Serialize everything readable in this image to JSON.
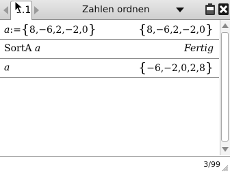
{
  "titlebar": {
    "tab_label": "1.1",
    "document_title": "Zahlen ordnen",
    "icons": {
      "prev": "arrow-left-icon",
      "next": "arrow-right-icon",
      "dropdown": "chevron-down-icon",
      "battery": "battery-icon",
      "close": "close-icon"
    }
  },
  "history": [
    {
      "input_var": "a",
      "input_op": ":=",
      "input_set": "8,−6,2,−2,0",
      "result_set": "8,−6,2,−2,0"
    },
    {
      "input_cmd": "SortA",
      "input_var": "a",
      "result_text": "Fertig"
    },
    {
      "input_var": "a",
      "result_set": "−6,−2,0,2,8"
    }
  ],
  "status": {
    "entry_count": "3/99"
  },
  "colors": {
    "titlebar_bg": "#d9d9d9",
    "divider": "#8c8c8c",
    "text": "#000000"
  }
}
